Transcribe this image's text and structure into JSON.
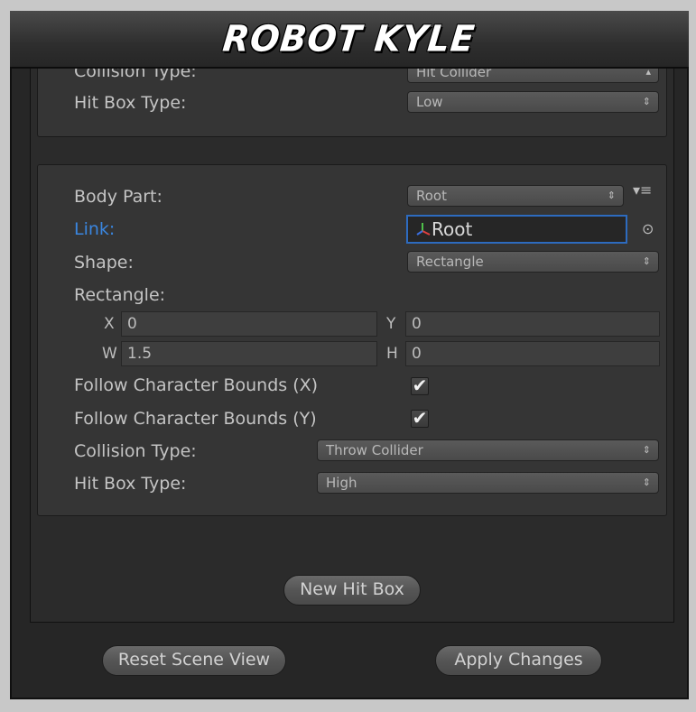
{
  "window": {
    "title": "ROBOT KYLE"
  },
  "panel_top": {
    "collision_type": {
      "label": "Collision Type:",
      "value": "Hit Collider"
    },
    "hit_box_type": {
      "label": "Hit Box Type:",
      "value": "Low"
    }
  },
  "panel_main": {
    "body_part": {
      "label": "Body Part:",
      "value": "Root"
    },
    "link": {
      "label": "Link:",
      "value": "Root"
    },
    "shape": {
      "label": "Shape:",
      "value": "Rectangle"
    },
    "rectangle": {
      "label": "Rectangle:",
      "x_label": "X",
      "x_value": "0",
      "y_label": "Y",
      "y_value": "0",
      "w_label": "W",
      "w_value": "1.5",
      "h_label": "H",
      "h_value": "0"
    },
    "follow_x": {
      "label": "Follow Character Bounds (X)",
      "checked": true
    },
    "follow_y": {
      "label": "Follow Character Bounds (Y)",
      "checked": true
    },
    "collision_type": {
      "label": "Collision Type:",
      "value": "Throw Collider"
    },
    "hit_box_type": {
      "label": "Hit Box Type:",
      "value": "High"
    }
  },
  "buttons": {
    "new_hit_box": "New Hit Box",
    "reset_scene_view": "Reset Scene View",
    "apply_changes": "Apply Changes"
  },
  "icons": {
    "dropdown_arrows": "⇕",
    "checkmark": "✔",
    "context_menu": "▾≡",
    "object_picker": "⊙"
  },
  "colors": {
    "link_label": "#3a86e0",
    "selected_field_border": "#2d6bbf",
    "background": "#262626"
  }
}
